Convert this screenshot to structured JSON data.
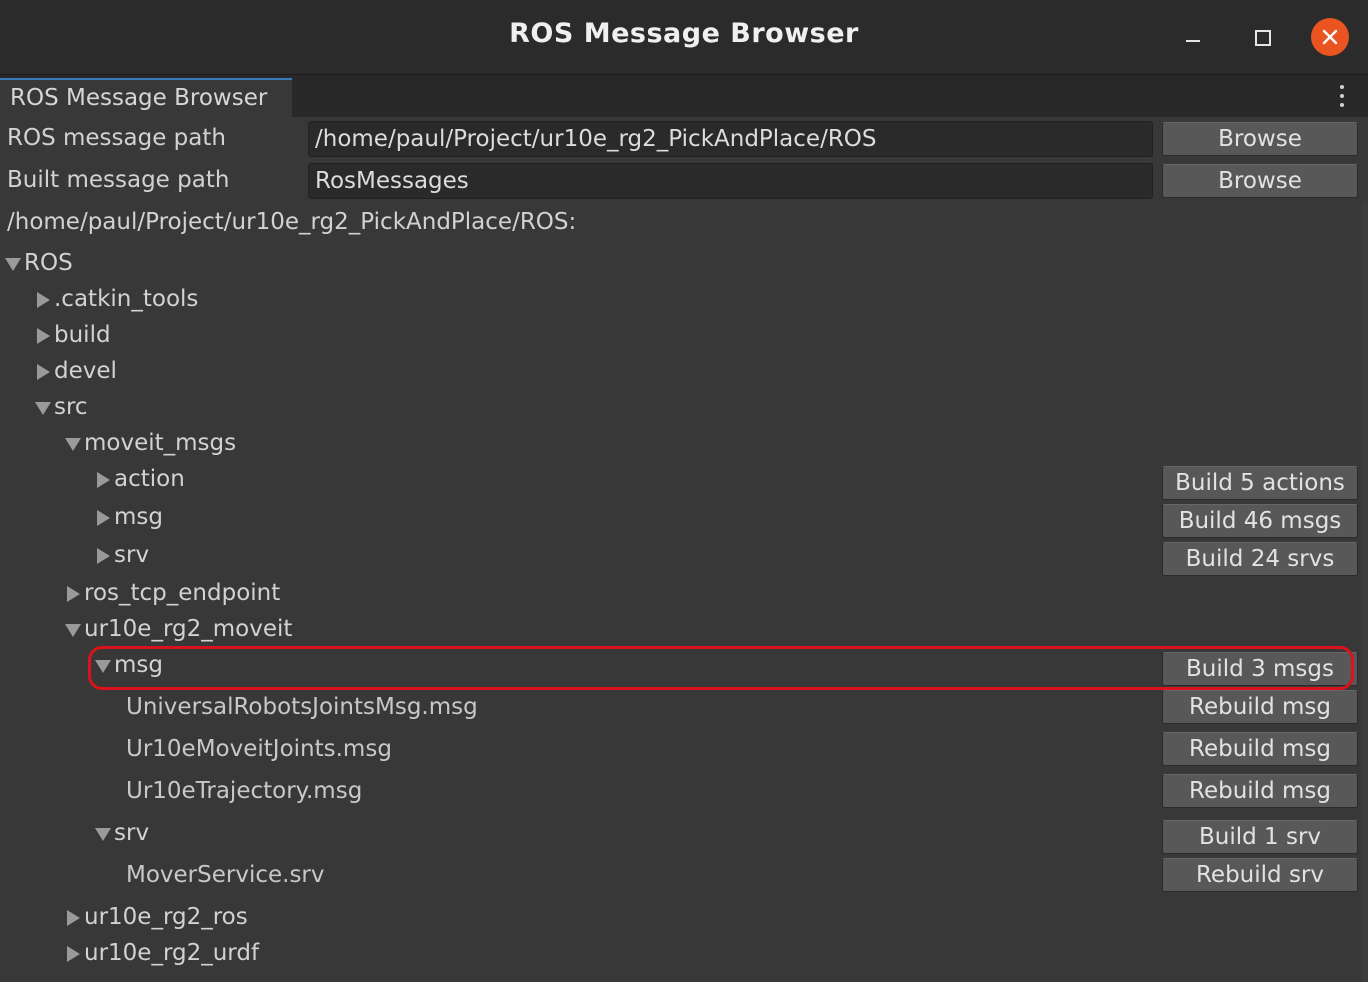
{
  "window": {
    "title": "ROS Message Browser"
  },
  "tab": {
    "label": "ROS Message Browser"
  },
  "fields": {
    "ros_path": {
      "label": "ROS message path",
      "value": "/home/paul/Project/ur10e_rg2_PickAndPlace/ROS",
      "browse_label": "Browse"
    },
    "built_path": {
      "label": "Built message path",
      "value": "RosMessages",
      "browse_label": "Browse"
    }
  },
  "current_path": "/home/paul/Project/ur10e_rg2_PickAndPlace/ROS:",
  "tree": {
    "root": "ROS",
    "catkin_tools": ".catkin_tools",
    "build": "build",
    "devel": "devel",
    "src": "src",
    "moveit_msgs": "moveit_msgs",
    "moveit_action": "action",
    "moveit_msg": "msg",
    "moveit_srv": "srv",
    "ros_tcp_endpoint": "ros_tcp_endpoint",
    "ur10e_rg2_moveit": "ur10e_rg2_moveit",
    "ur_msg": "msg",
    "ur_msg_file1": "UniversalRobotsJointsMsg.msg",
    "ur_msg_file2": "Ur10eMoveitJoints.msg",
    "ur_msg_file3": "Ur10eTrajectory.msg",
    "ur_srv": "srv",
    "ur_srv_file1": "MoverService.srv",
    "ur10e_rg2_ros": "ur10e_rg2_ros",
    "ur10e_rg2_urdf": "ur10e_rg2_urdf"
  },
  "buttons": {
    "build_actions": "Build 5 actions",
    "build_msgs_46": "Build 46 msgs",
    "build_srvs_24": "Build 24 srvs",
    "build_msgs_3": "Build 3 msgs",
    "rebuild_msg_1": "Rebuild msg",
    "rebuild_msg_2": "Rebuild msg",
    "rebuild_msg_3": "Rebuild msg",
    "build_srv_1": "Build 1 srv",
    "rebuild_srv": "Rebuild srv"
  },
  "colors": {
    "background": "#383838",
    "titlebar": "#2b2b2b",
    "close_button": "#e95420",
    "highlight": "#d8131b",
    "tab_accent": "#3a79bb"
  }
}
